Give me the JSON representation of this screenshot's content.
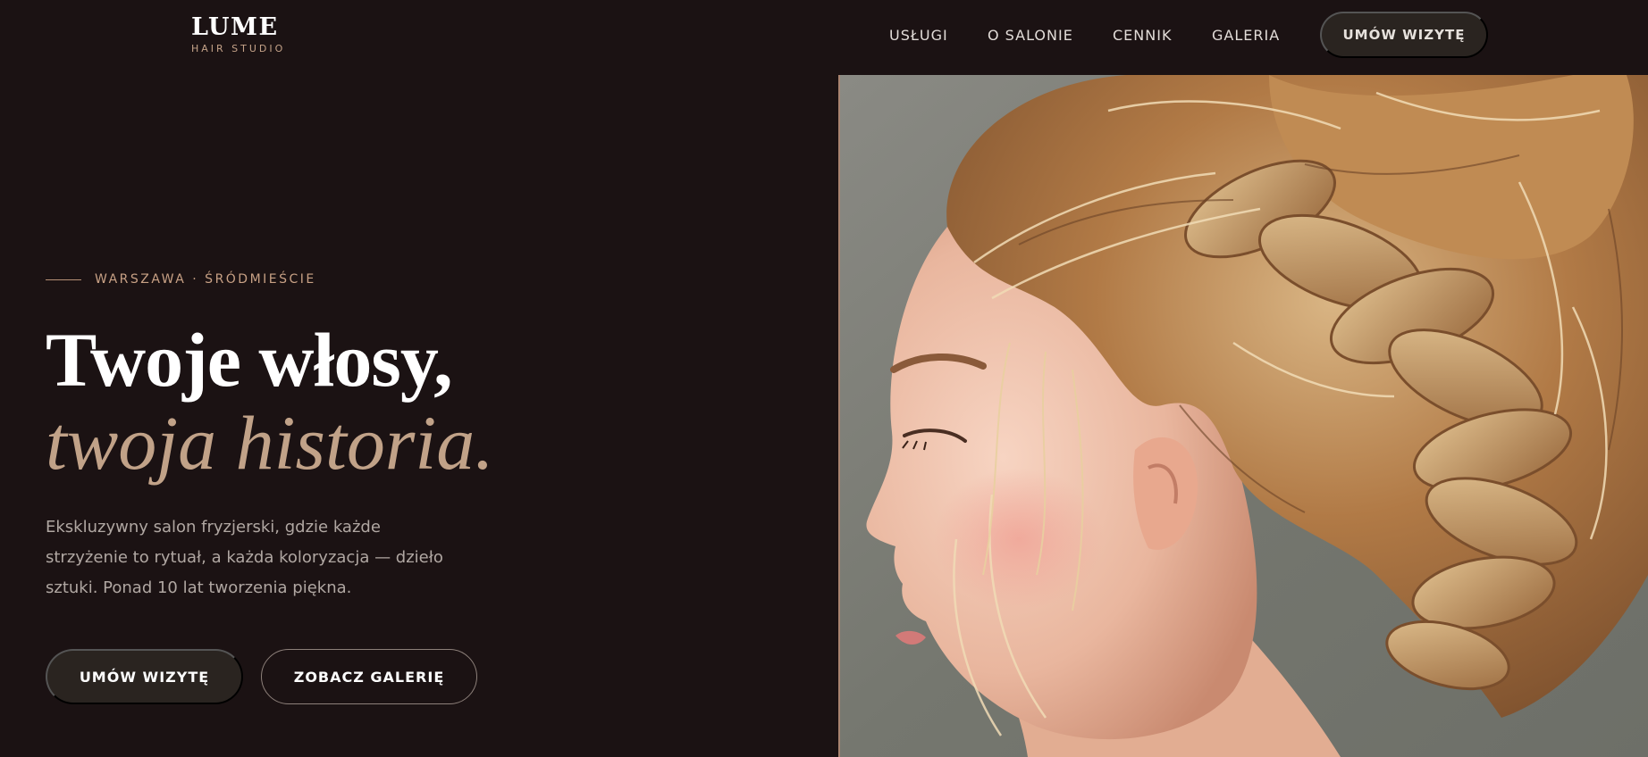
{
  "brand": {
    "name": "LUME",
    "tagline": "HAIR STUDIO"
  },
  "nav": {
    "links": [
      "USŁUGI",
      "O SALONIE",
      "CENNIK",
      "GALERIA"
    ],
    "cta": "UMÓW WIZYTĘ"
  },
  "hero": {
    "eyebrow": "WARSZAWA · ŚRÓDMIEŚCIE",
    "headline": "Twoje włosy,",
    "headline_accent": "twoja historia.",
    "description": "Ekskluzywny salon fryzjerski, gdzie każde strzyżenie to rytuał, a każda koloryzacja — dzieło sztuki. Ponad 10 lat tworzenia piękna.",
    "primary_button": "UMÓW WIZYTĘ",
    "secondary_button": "ZOBACZ GALERIĘ"
  },
  "colors": {
    "background": "#1b1213",
    "accent": "#c1a288",
    "button_dark": "#2a2420"
  }
}
